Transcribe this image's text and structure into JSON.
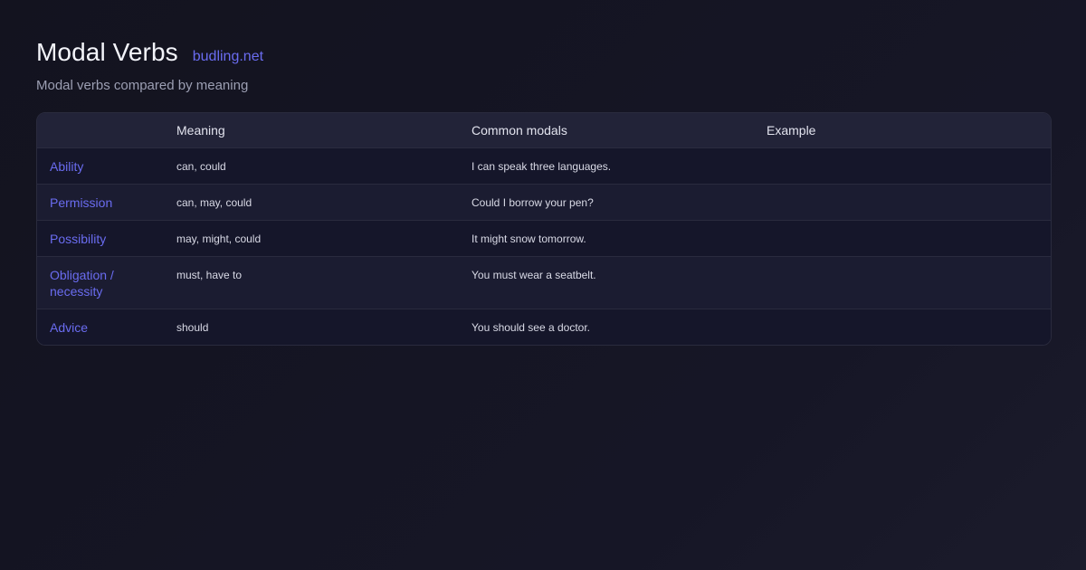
{
  "header": {
    "title": "Modal Verbs",
    "site": "budling.net",
    "subtitle": "Modal verbs compared by meaning"
  },
  "table": {
    "columns": [
      "",
      "Meaning",
      "Common modals",
      "Example"
    ],
    "rows": [
      {
        "label": "Ability",
        "meaning": "can, could",
        "modals": "I can speak three languages.",
        "example": ""
      },
      {
        "label": "Permission",
        "meaning": "can, may, could",
        "modals": "Could I borrow your pen?",
        "example": ""
      },
      {
        "label": "Possibility",
        "meaning": "may, might, could",
        "modals": "It might snow tomorrow.",
        "example": ""
      },
      {
        "label": "Obligation / necessity",
        "meaning": "must, have to",
        "modals": "You must wear a seatbelt.",
        "example": ""
      },
      {
        "label": "Advice",
        "meaning": "should",
        "modals": "You should see a doctor.",
        "example": ""
      }
    ]
  },
  "colors": {
    "accent": "#6a6cf0",
    "background": "#13131f",
    "header_row": "#222338"
  }
}
